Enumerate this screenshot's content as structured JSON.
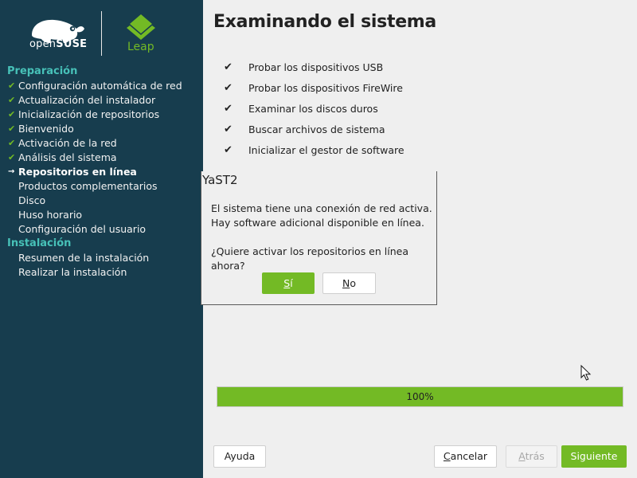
{
  "sidebar": {
    "logo_open": "open",
    "logo_suse": "SUSE",
    "logo_leap": "Leap",
    "colors": {
      "background": "#173d4e",
      "section": "#47c1b8",
      "check": "#73ba25"
    },
    "steps": [
      {
        "kind": "section",
        "label": "Preparación"
      },
      {
        "kind": "step",
        "state": "done",
        "label": "Configuración automática de red"
      },
      {
        "kind": "step",
        "state": "done",
        "label": "Actualización del instalador"
      },
      {
        "kind": "step",
        "state": "done",
        "label": "Inicialización de repositorios"
      },
      {
        "kind": "step",
        "state": "done",
        "label": "Bienvenido"
      },
      {
        "kind": "step",
        "state": "done",
        "label": "Activación de la red"
      },
      {
        "kind": "step",
        "state": "done",
        "label": "Análisis del sistema"
      },
      {
        "kind": "step",
        "state": "current",
        "label": "Repositorios en línea"
      },
      {
        "kind": "step",
        "state": "pending",
        "label": "Productos complementarios"
      },
      {
        "kind": "step",
        "state": "pending",
        "label": "Disco"
      },
      {
        "kind": "step",
        "state": "pending",
        "label": "Huso horario"
      },
      {
        "kind": "step",
        "state": "pending",
        "label": "Configuración del usuario"
      },
      {
        "kind": "section",
        "label": "Instalación"
      },
      {
        "kind": "step",
        "state": "pending",
        "label": "Resumen de la instalación"
      },
      {
        "kind": "step",
        "state": "pending",
        "label": "Realizar la instalación"
      }
    ]
  },
  "main": {
    "title": "Examinando el sistema",
    "checklist": [
      "Probar los dispositivos USB",
      "Probar los dispositivos FireWire",
      "Examinar los discos duros",
      "Buscar archivos de sistema",
      "Inicializar el gestor de software"
    ],
    "check_icon": "check-icon",
    "progress": {
      "percent": 100,
      "label": "100%",
      "color": "#73ba25"
    }
  },
  "dialog": {
    "title": "YaST2",
    "line1": "El sistema tiene una conexión de red activa.",
    "line2": "Hay software adicional disponible en línea.",
    "question": "¿Quiere activar los repositorios en línea ahora?",
    "yes_key": "S",
    "yes_rest": "í",
    "no_key": "N",
    "no_rest": "o"
  },
  "buttons": {
    "help": "Ayuda",
    "cancel_key": "C",
    "cancel_rest": "ancelar",
    "back_key": "A",
    "back_rest": "trás",
    "next": "Siguiente"
  }
}
